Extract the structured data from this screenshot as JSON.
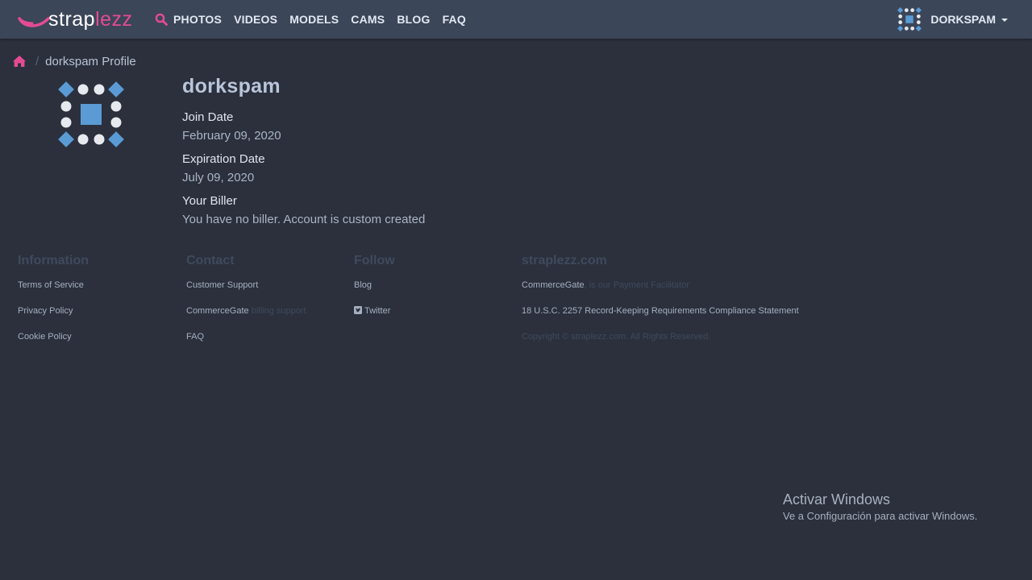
{
  "nav": {
    "logo": {
      "part1": "strap",
      "part2": "lezz"
    },
    "search_icon": "search-icon",
    "links": [
      "PHOTOS",
      "VIDEOS",
      "MODELS",
      "CAMS",
      "BLOG",
      "FAQ"
    ],
    "user": {
      "name": "DORKSPAM",
      "avatar_icon": "identicon"
    }
  },
  "breadcrumb": {
    "home_icon": "home-icon",
    "separator": "/",
    "current": "dorkspam Profile"
  },
  "profile": {
    "name": "dorkspam",
    "fields": [
      {
        "label": "Join Date",
        "value": "February 09, 2020"
      },
      {
        "label": "Expiration Date",
        "value": "July 09, 2020"
      },
      {
        "label": "Your Biller",
        "value": "You have no biller. Account is custom created"
      }
    ]
  },
  "footer": {
    "information": {
      "heading": "Information",
      "items": [
        "Terms of Service",
        "Privacy Policy",
        "Cookie Policy"
      ]
    },
    "contact": {
      "heading": "Contact",
      "support": "Customer Support",
      "commercegate": "CommerceGate",
      "billing_support": "billing support",
      "faq": "FAQ"
    },
    "follow": {
      "heading": "Follow",
      "blog": "Blog",
      "twitter": "Twitter",
      "twitter_icon": "twitter-icon"
    },
    "site": {
      "heading": "straplezz.com",
      "commercegate": "CommerceGate",
      "facilitator": ", is our Payment Facilitator",
      "compliance": "18 U.S.C. 2257 Record-Keeping Requirements Compliance Statement",
      "copyright": "Copyright © straplezz.com. All Rights Reserved."
    }
  },
  "watermark": {
    "title": "Activar Windows",
    "subtitle": "Ve a Configuración para activar Windows."
  },
  "colors": {
    "background": "#2b303c",
    "navbar": "#3b4658",
    "accent_pink": "#e54b93",
    "identicon_blue": "#5b9bd5",
    "identicon_dot": "#e6e9ee"
  }
}
